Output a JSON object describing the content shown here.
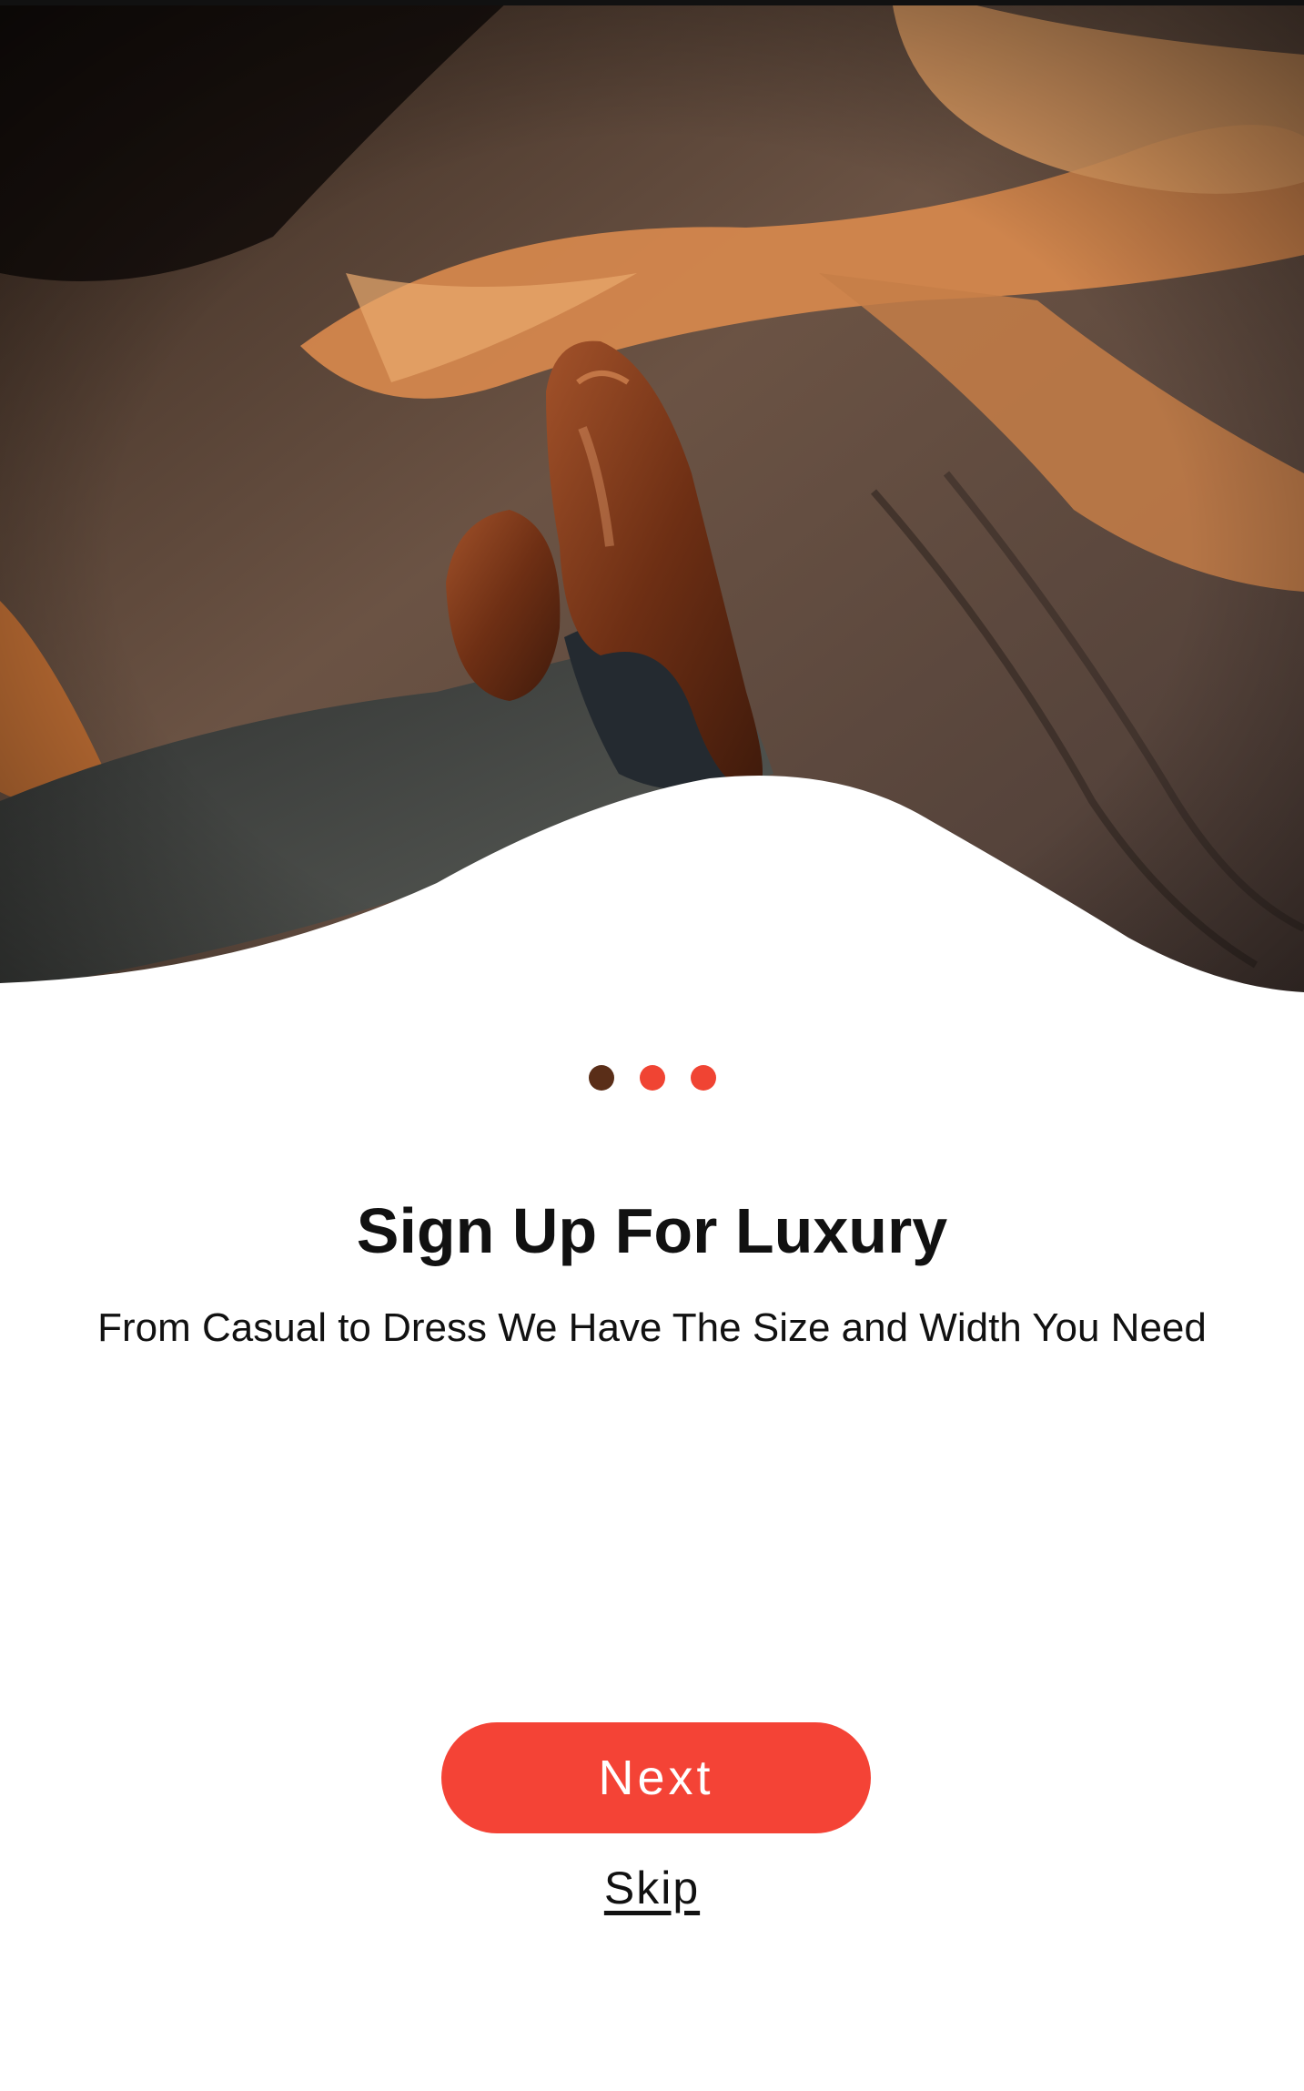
{
  "onboarding": {
    "title": "Sign Up For Luxury",
    "subtitle": "From Casual to Dress We Have The Size and Width You Need",
    "next_label": "Next",
    "skip_label": "Skip"
  },
  "pager": {
    "count": 3,
    "active_index": 0,
    "colors": {
      "active": "#5a2e18",
      "inactive": "#f04433"
    }
  },
  "theme": {
    "accent": "#f44336"
  },
  "hero_image": {
    "subject": "brown-leather-brogue-shoes-on-patterned-carpet"
  }
}
